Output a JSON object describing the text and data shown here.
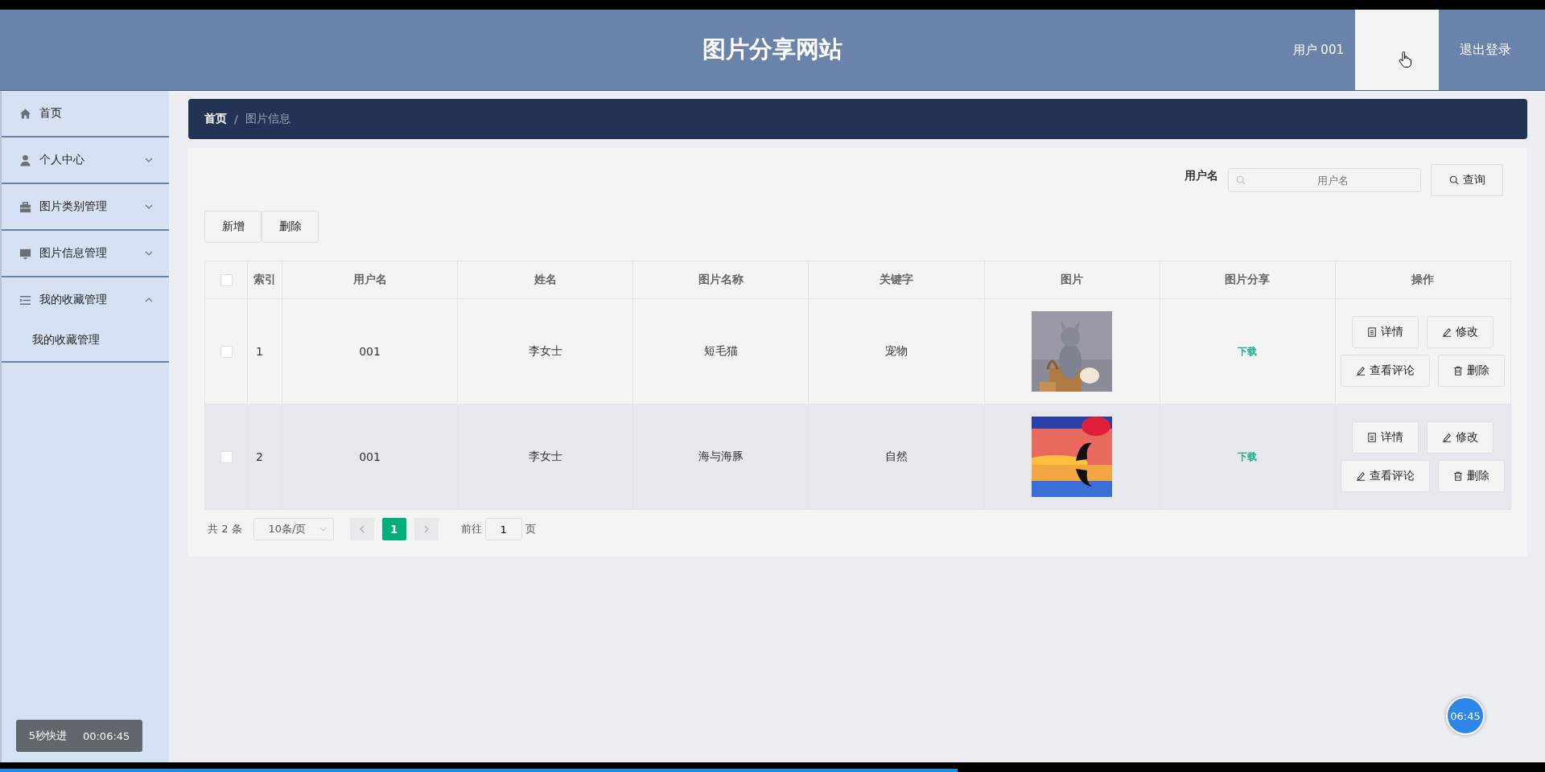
{
  "header": {
    "title": "图片分享网站",
    "user": "用户 001",
    "logout": "退出登录"
  },
  "sidebar": {
    "items": [
      {
        "label": "首页"
      },
      {
        "label": "个人中心",
        "expanded": false
      },
      {
        "label": "图片类别管理",
        "expanded": false
      },
      {
        "label": "图片信息管理",
        "expanded": false
      },
      {
        "label": "我的收藏管理",
        "expanded": true,
        "children": [
          {
            "label": "我的收藏管理"
          }
        ]
      }
    ]
  },
  "breadcrumb": {
    "items": [
      "首页",
      "图片信息"
    ],
    "separator": "/"
  },
  "search": {
    "label": "用户名",
    "placeholder": "用户名",
    "button": "查询"
  },
  "actions": [
    "新增",
    "删除"
  ],
  "table": {
    "select_all": {
      "checked": false
    },
    "columns": [
      "索引",
      "用户名",
      "姓名",
      "图片名称",
      "关键字",
      "图片",
      "图片分享",
      "操作"
    ],
    "rows": [
      {
        "checked": false,
        "highlighted": false,
        "index": "1",
        "username": "001",
        "name": "李女士",
        "title": "短毛猫",
        "keyword": "宠物",
        "image": {
          "kind": "picture"
        },
        "share": "下载",
        "ops": [
          "详情",
          "修改",
          "查看评论",
          "删除"
        ]
      },
      {
        "checked": false,
        "highlighted": true,
        "index": "2",
        "username": "001",
        "name": "李女士",
        "title": "海与海豚",
        "keyword": "自然",
        "image": {
          "kind": "picture"
        },
        "share": "下载",
        "ops": [
          "详情",
          "修改",
          "查看评论",
          "删除"
        ]
      }
    ]
  },
  "pagination": {
    "total": "共 2 条",
    "page_size": "10条/页",
    "pages": [
      {
        "label": "1",
        "selected": true
      }
    ],
    "goto": "前往",
    "goto_value": "1",
    "goto_suffix": "页"
  },
  "player": {
    "toast_label": "5秒快进",
    "toast_time": "00:06:45",
    "timer": "06:45",
    "progress": {
      "level": 0.62
    }
  }
}
